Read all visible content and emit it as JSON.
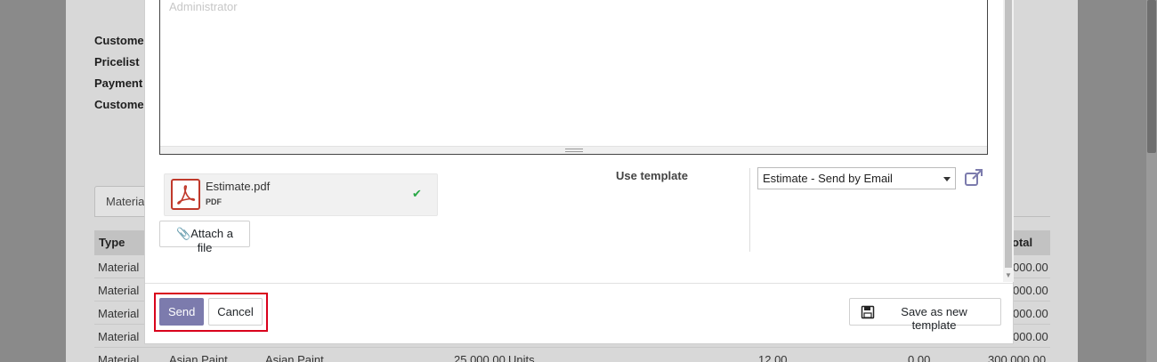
{
  "background": {
    "labels": [
      "Custome",
      "Pricelist",
      "Payment",
      "Custome"
    ],
    "tab_label": "Materia",
    "table_headers": [
      "Type",
      "otal"
    ],
    "rows": [
      {
        "type": "Material",
        "total": "000.00"
      },
      {
        "type": "Material",
        "total": "000.00"
      },
      {
        "type": "Material",
        "total": "000.00"
      },
      {
        "type": "Material",
        "total": "000.00"
      },
      {
        "type": "Material",
        "col2": "Asian Paint",
        "col3": "Asian Paint",
        "qty": "25,000.00",
        "unit": "Units",
        "price": "12.00",
        "disc": "0.00",
        "total": "300,000.00"
      }
    ]
  },
  "editor": {
    "placeholder": "Administrator"
  },
  "attachment": {
    "name": "Estimate.pdf",
    "type": "PDF",
    "icon": "pdf-file-icon"
  },
  "attach_button_label": "Attach a file",
  "template": {
    "label": "Use template",
    "selected": "Estimate - Send by Email"
  },
  "footer": {
    "send_label": "Send",
    "cancel_label": "Cancel",
    "save_template_label": "Save as new template"
  },
  "colors": {
    "primary": "#7c7bad",
    "highlight": "#d9001b",
    "check": "#28a745",
    "pdf": "#c0392b"
  }
}
